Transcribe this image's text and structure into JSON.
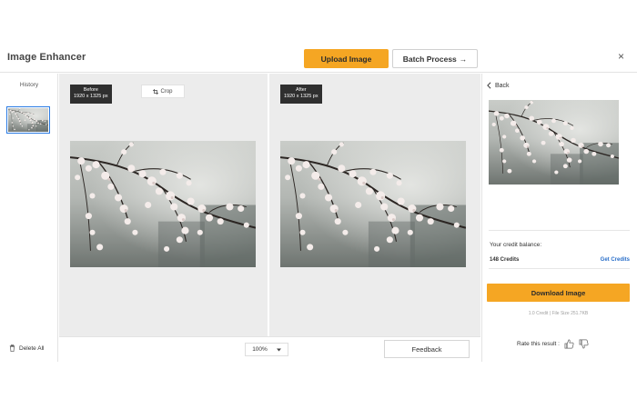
{
  "header": {
    "title": "Image Enhancer",
    "upload_label": "Upload Image",
    "batch_label": "Batch Process",
    "batch_arrow": "→",
    "close_glyph": "×"
  },
  "sidebar": {
    "history_label": "History",
    "delete_label": "Delete All"
  },
  "before_panel": {
    "label": "Before",
    "dimensions": "1920 x 1325 px",
    "crop_label": "Crop"
  },
  "after_panel": {
    "label": "After",
    "dimensions": "1920 x 1325 px"
  },
  "bottom_bar": {
    "zoom_value": "100%",
    "feedback_label": "Feedback"
  },
  "right_panel": {
    "back_label": "Back",
    "credit_balance_label": "Your credit balance:",
    "credits_value": "148 Credits",
    "get_credits_label": "Get Credits",
    "download_label": "Download Image",
    "file_info": "1.0 Credit | File Size 251.7KB",
    "rate_label": "Rate this result :"
  },
  "colors": {
    "accent": "#f5a623",
    "link": "#2a6fc9",
    "selection": "#2a7be4",
    "tag_bg": "#2f2f2f"
  },
  "icons": [
    "close-icon",
    "trash-icon",
    "crop-icon",
    "chevron-down-icon",
    "chevron-left-icon",
    "thumbs-up-icon",
    "thumbs-down-icon",
    "arrow-right-icon"
  ]
}
